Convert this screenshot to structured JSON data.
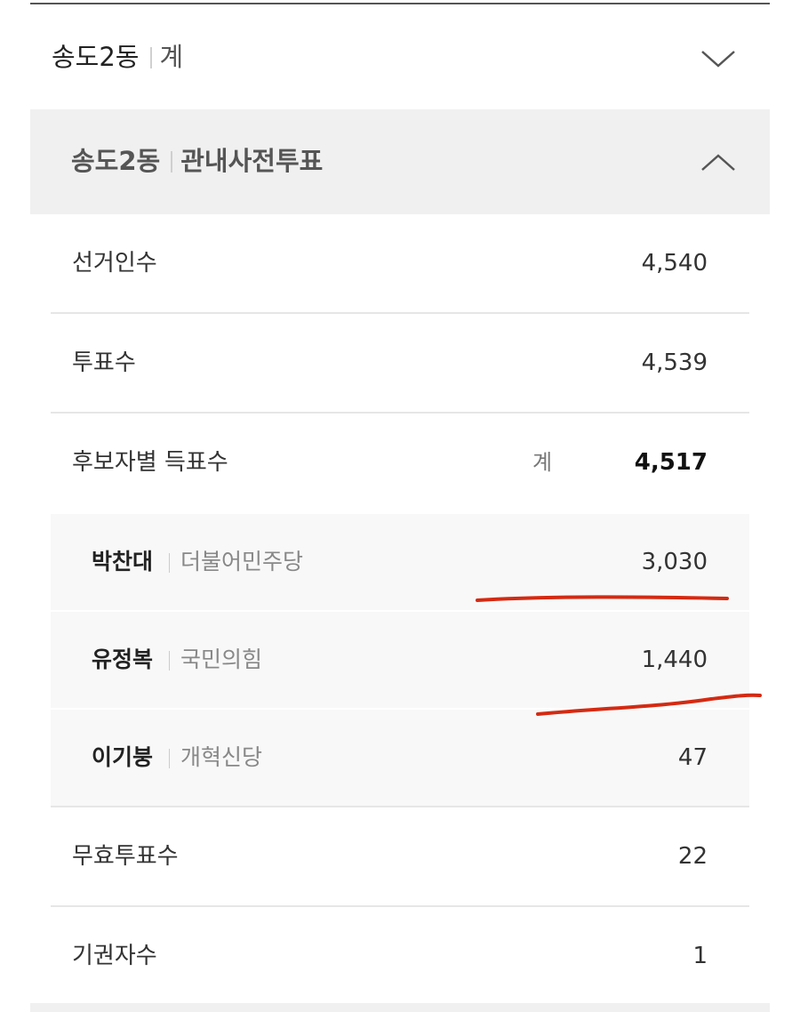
{
  "district_header": {
    "name": "송도2동",
    "subtitle": "계",
    "toggle_icon": "chevron-down-icon"
  },
  "section": {
    "name": "송도2동",
    "subtitle": "관내사전투표",
    "toggle_icon": "chevron-up-icon"
  },
  "stats": {
    "electorate": {
      "label": "선거인수",
      "value": "4,540"
    },
    "votes_cast": {
      "label": "투표수",
      "value": "4,539"
    },
    "candidate_votes": {
      "label": "후보자별 득표수",
      "sum_label": "계",
      "value": "4,517"
    }
  },
  "candidates": [
    {
      "name": "박찬대",
      "party": "더불어민주당",
      "votes": "3,030"
    },
    {
      "name": "유정복",
      "party": "국민의힘",
      "votes": "1,440"
    },
    {
      "name": "이기붕",
      "party": "개혁신당",
      "votes": "47"
    }
  ],
  "footer_stats": {
    "invalid": {
      "label": "무효투표수",
      "value": "22"
    },
    "abstention": {
      "label": "기권자수",
      "value": "1"
    }
  },
  "colors": {
    "annotation_red": "#d42a12",
    "section_bg": "#f0f0f0",
    "candidate_bg": "#f8f8f8"
  }
}
